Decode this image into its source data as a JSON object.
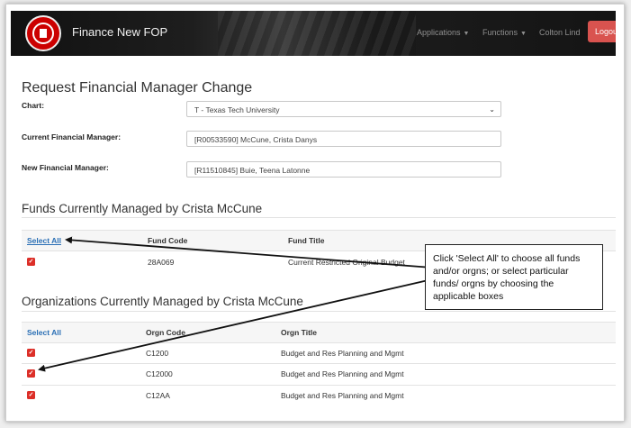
{
  "navbar": {
    "title": "Finance New FOP",
    "applications": "Applications",
    "functions": "Functions",
    "user": "Colton Lind",
    "logout": "Logou"
  },
  "form": {
    "heading": "Request Financial Manager Change",
    "chart_label": "Chart:",
    "chart_value": "T - Texas Tech University",
    "current_label": "Current Financial Manager:",
    "current_value": "[R00533590] McCune, Crista Danys",
    "new_label": "New Financial Manager:",
    "new_value": "[R11510845] Buie, Teena Latonne"
  },
  "funds": {
    "heading": "Funds Currently Managed by Crista McCune",
    "select_all": "Select All",
    "col_code": "Fund Code",
    "col_title": "Fund Title",
    "rows": [
      {
        "code": "28A069",
        "title": "Current Restricted Original Budget",
        "checked": true
      }
    ]
  },
  "orgs": {
    "heading": "Organizations Currently Managed by Crista McCune",
    "select_all": "Select All",
    "col_code": "Orgn Code",
    "col_title": "Orgn Title",
    "rows": [
      {
        "code": "C1200",
        "title": "Budget and Res Planning and Mgmt",
        "checked": true
      },
      {
        "code": "C12000",
        "title": "Budget and Res Planning and Mgmt",
        "checked": true
      },
      {
        "code": "C12AA",
        "title": "Budget and Res Planning and Mgmt",
        "checked": true
      }
    ]
  },
  "callout": {
    "text": "Click 'Select All' to choose all funds and/or orgns; or select particular funds/ orgns by choosing the applicable boxes"
  },
  "colors": {
    "accent_red": "#dc2f28",
    "link_blue": "#2a6fb5",
    "navbar": "#1a1a1a"
  }
}
